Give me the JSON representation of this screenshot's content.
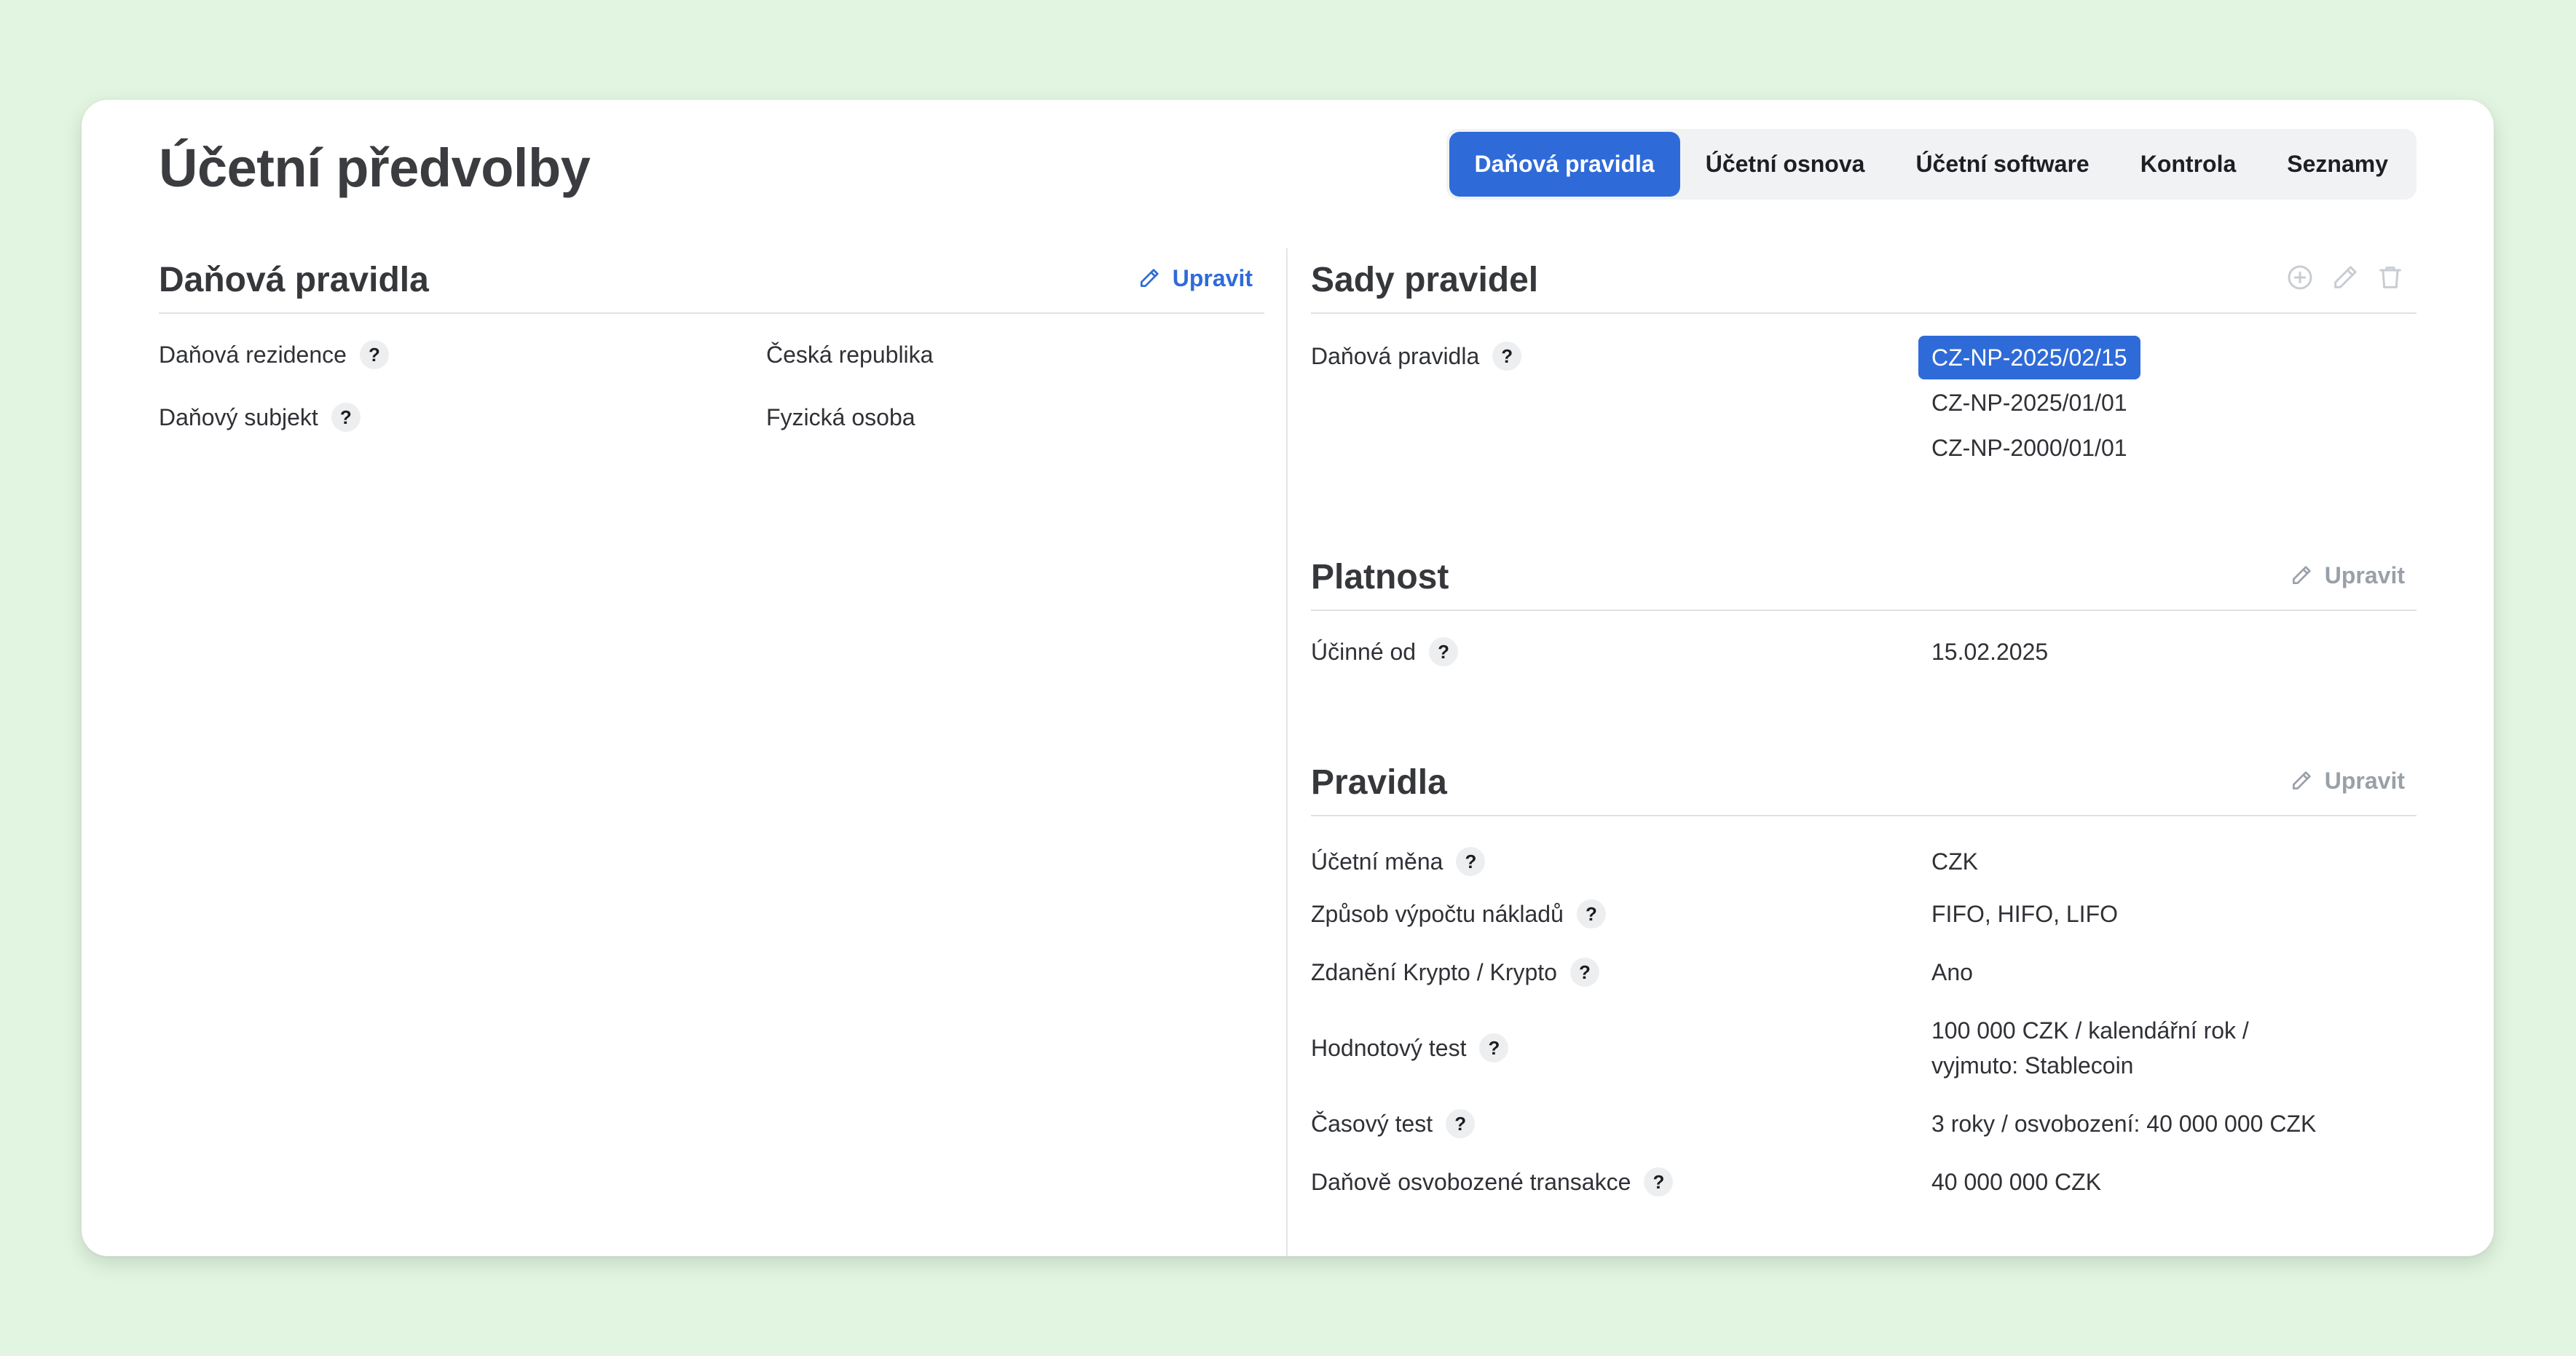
{
  "page": {
    "title": "Účetní předvolby"
  },
  "tabs": [
    {
      "label": "Daňová pravidla",
      "active": true
    },
    {
      "label": "Účetní osnova",
      "active": false
    },
    {
      "label": "Účetní software",
      "active": false
    },
    {
      "label": "Kontrola",
      "active": false
    },
    {
      "label": "Seznamy",
      "active": false
    }
  ],
  "tax_rules": {
    "title": "Daňová pravidla",
    "edit_label": "Upravit",
    "rows": [
      {
        "label": "Daňová rezidence",
        "value": "Česká republika"
      },
      {
        "label": "Daňový subjekt",
        "value": "Fyzická osoba"
      }
    ]
  },
  "rule_sets": {
    "title": "Sady pravidel",
    "label": "Daňová pravidla",
    "items": [
      "CZ-NP-2025/02/15",
      "CZ-NP-2025/01/01",
      "CZ-NP-2000/01/01"
    ],
    "selected": "CZ-NP-2025/02/15",
    "icons": [
      "add-circle-icon",
      "pencil-icon",
      "trash-icon"
    ]
  },
  "validity": {
    "title": "Platnost",
    "edit_label": "Upravit",
    "rows": [
      {
        "label": "Účinné od",
        "value": "15.02.2025"
      }
    ]
  },
  "rules": {
    "title": "Pravidla",
    "edit_label": "Upravit",
    "rows": [
      {
        "label": "Účetní měna",
        "value": "CZK"
      },
      {
        "label": "Způsob výpočtu nákladů",
        "value": "FIFO, HIFO, LIFO"
      },
      {
        "label": "Zdanění Krypto / Krypto",
        "value": "Ano"
      },
      {
        "label": "Hodnotový test",
        "value_line1": "100 000 CZK / kalendářní rok /",
        "value_line2": "vyjmuto: Stablecoin"
      },
      {
        "label": "Časový test",
        "value": "3 roky / osvobození: 40 000 000 CZK"
      },
      {
        "label": "Daňově osvobozené transakce",
        "value": "40 000 000 CZK"
      }
    ]
  },
  "help_glyph": "?",
  "colors": {
    "accent": "#2f6bd8",
    "background": "#e1f5e1",
    "muted": "#9aa0a8"
  }
}
